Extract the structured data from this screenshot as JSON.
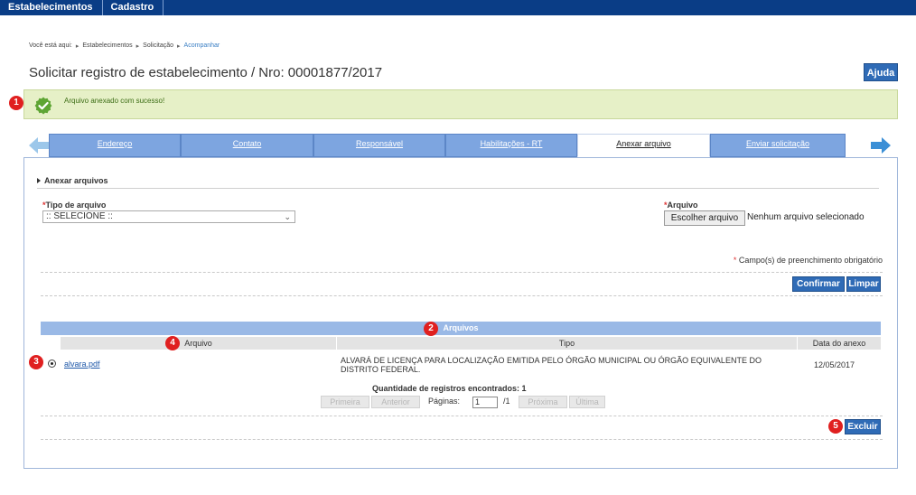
{
  "topnav": {
    "items": [
      "Estabelecimentos",
      "Cadastro"
    ]
  },
  "breadcrumb": {
    "prefix": "Você está aqui:",
    "items": [
      "Estabelecimentos",
      "Solicitação"
    ],
    "current": "Acompanhar",
    "separator": "▸"
  },
  "page": {
    "title": "Solicitar registro de estabelecimento / Nro: 00001877/2017",
    "help_label": "Ajuda"
  },
  "alert": {
    "message": "Arquivo anexado com sucesso!",
    "icon": "check-circle-icon",
    "color": "#5ea534"
  },
  "badges": [
    "1",
    "2",
    "3",
    "4",
    "5"
  ],
  "tabs": [
    {
      "label": "Endereço",
      "active": false
    },
    {
      "label": "Contato",
      "active": false
    },
    {
      "label": "Responsável",
      "active": false
    },
    {
      "label": "Habilitações - RT",
      "active": false
    },
    {
      "label": "Anexar arquivo",
      "active": true
    },
    {
      "label": "Enviar solicitação",
      "active": false
    }
  ],
  "form": {
    "section_title": "Anexar arquivos",
    "required_mark": "*",
    "file_type_label": "Tipo de arquivo",
    "file_type_value": ":: SELECIONE ::",
    "file_label": "Arquivo",
    "choose_file_label": "Escolher arquivo",
    "no_file_text": "Nenhum arquivo selecionado",
    "required_note": "Campo(s) de preenchimento obrigatório",
    "confirm_label": "Confirmar",
    "clear_label": "Limpar"
  },
  "table": {
    "title": "Arquivos",
    "columns": [
      "Arquivo",
      "Tipo",
      "Data do anexo"
    ],
    "rows": [
      {
        "arquivo": "alvara.pdf",
        "tipo_line1": "ALVARÁ DE LICENÇA PARA LOCALIZAÇÃO EMITIDA PELO ÓRGÃO MUNICIPAL OU ÓRGÃO EQUIVALENTE DO",
        "tipo_line2": "DISTRITO FEDERAL.",
        "data": "12/05/2017",
        "selected": true
      }
    ],
    "count_label": "Quantidade de registros encontrados:",
    "count_value": "1",
    "pager": {
      "first": "Primeira",
      "prev": "Anterior",
      "pages_label": "Páginas:",
      "page_value": "1",
      "total": "/1",
      "next": "Próxima",
      "last": "Última"
    },
    "delete_label": "Excluir"
  },
  "colors": {
    "nav": "#0a3d86",
    "tab": "#7da5e0",
    "button": "#2f6bb6",
    "badge": "#e02020"
  }
}
